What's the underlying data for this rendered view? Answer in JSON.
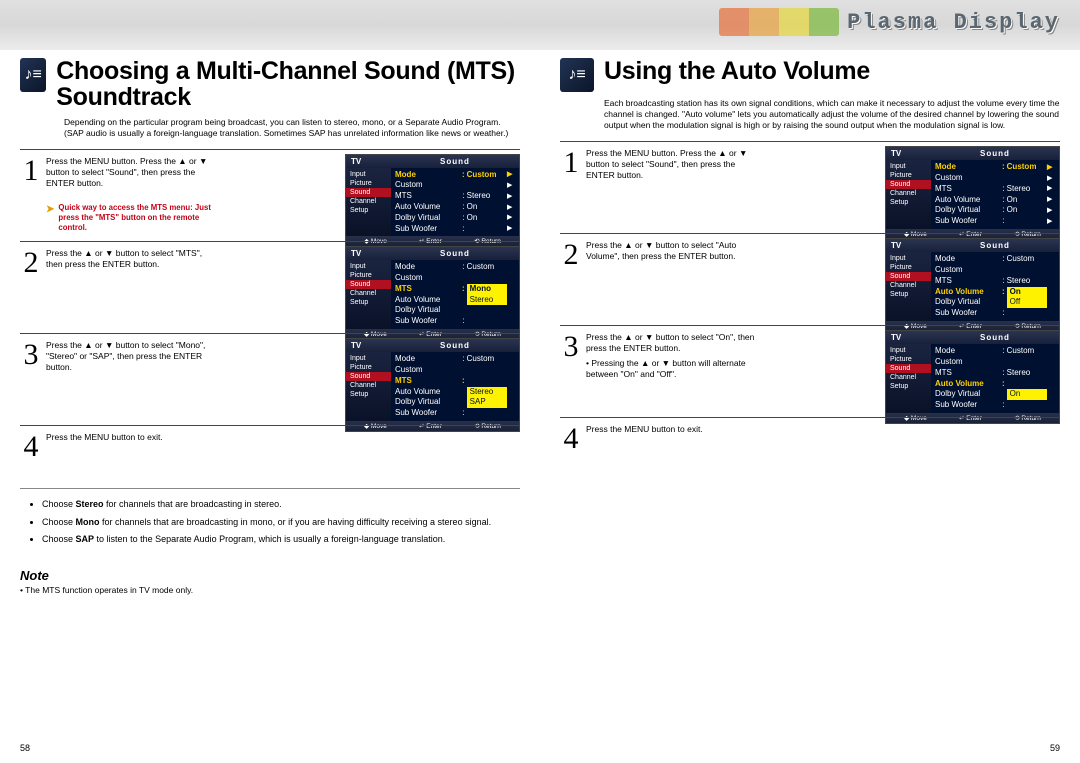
{
  "logo": "Plasma Display",
  "left": {
    "title": "Choosing a Multi-Channel Sound (MTS) Soundtrack",
    "intro": "Depending on the particular program being broadcast, you can listen to stereo, mono, or a Separate Audio Program. (SAP audio is usually a foreign-language translation. Sometimes SAP has unrelated information like news or weather.)",
    "steps": [
      {
        "n": "1",
        "text": "Press the MENU button. Press the ▲ or ▼ button to select \"Sound\", then press the ENTER button.",
        "hint": "Quick way to access the MTS menu: Just press the \"MTS\" button on the remote control."
      },
      {
        "n": "2",
        "text": "Press the ▲ or ▼ button to select \"MTS\", then press the ENTER button."
      },
      {
        "n": "3",
        "text": "Press the ▲ or ▼ button to select \"Mono\", \"Stereo\" or \"SAP\", then press the ENTER button."
      },
      {
        "n": "4",
        "text": "Press the MENU button to exit."
      }
    ],
    "bullets": [
      {
        "k": "Stereo",
        "t": " for channels that are broadcasting in stereo."
      },
      {
        "k": "Mono",
        "t": " for channels that are broadcasting in mono, or if you are having difficulty receiving a stereo signal."
      },
      {
        "k": "SAP",
        "t": " to listen to the Separate Audio Program, which is usually a foreign-language translation."
      }
    ],
    "note_label": "Note",
    "note_text": "• The MTS function operates in TV mode only.",
    "pagenum": "58"
  },
  "right": {
    "title": "Using the Auto Volume",
    "intro": "Each broadcasting station has its own signal conditions, which can make it necessary to adjust the volume every time the channel is changed. \"Auto volume\" lets you automatically adjust the volume of the desired channel by lowering the sound output when the modulation signal is high or by raising the sound output when the modulation signal is low.",
    "steps": [
      {
        "n": "1",
        "text": "Press the MENU button. Press the ▲ or ▼ button to select \"Sound\", then press the ENTER button."
      },
      {
        "n": "2",
        "text": "Press the ▲ or ▼ button to select \"Auto Volume\", then press the ENTER button."
      },
      {
        "n": "3",
        "text": "Press the ▲ or ▼ button to select \"On\", then press the ENTER button.",
        "extra": "• Pressing the ▲ or ▼ button will alternate between \"On\" and \"Off\"."
      },
      {
        "n": "4",
        "text": "Press the MENU button to exit."
      }
    ],
    "pagenum": "59"
  },
  "osd": {
    "tv": "TV",
    "sound": "Sound",
    "side": [
      "Input",
      "Picture",
      "Sound",
      "Channel",
      "Setup"
    ],
    "footer": {
      "move": "◆ Move",
      "enter": "↵ Enter",
      "ret": "⟲ Return"
    },
    "rows": {
      "mode": {
        "l": "Mode",
        "r": "Custom"
      },
      "custom": {
        "l": "Custom",
        "r": ""
      },
      "mts": {
        "l": "MTS",
        "r": "Stereo"
      },
      "mts_mono": {
        "l": "MTS",
        "r": "Mono"
      },
      "autov": {
        "l": "Auto Volume",
        "r": "On"
      },
      "dolby": {
        "l": "Dolby Virtual",
        "r": "On"
      },
      "subw": {
        "l": "Sub Woofer",
        "r": ""
      },
      "mono": "Mono",
      "stereo": "Stereo",
      "sap": "SAP",
      "on": "On",
      "off": "Off"
    }
  }
}
